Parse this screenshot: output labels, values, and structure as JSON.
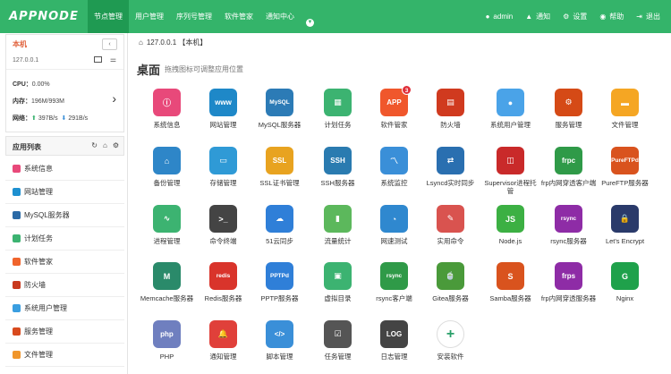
{
  "logo": "APPNODE",
  "nav": [
    {
      "label": "节点管理",
      "active": true
    },
    {
      "label": "用户管理"
    },
    {
      "label": "序列号管理"
    },
    {
      "label": "软件管家"
    },
    {
      "label": "通知中心"
    }
  ],
  "topright": {
    "user": "admin",
    "notify": "通知",
    "settings": "设置",
    "help": "帮助",
    "logout": "退出"
  },
  "host": {
    "name": "本机",
    "ip": "127.0.0.1",
    "cpu_label": "CPU：",
    "cpu": "0.00%",
    "mem_label": "内存：",
    "mem": "196M/993M",
    "net_label": "网络：",
    "net_up": "397B/s",
    "net_down": "291B/s"
  },
  "applist": {
    "title": "应用列表"
  },
  "side_items": [
    {
      "label": "系统信息",
      "color": "#e8497a"
    },
    {
      "label": "网站管理",
      "color": "#1e90d0"
    },
    {
      "label": "MySQL服务器",
      "color": "#2b6aa6"
    },
    {
      "label": "计划任务",
      "color": "#3cb371"
    },
    {
      "label": "软件管家",
      "color": "#f0642c"
    },
    {
      "label": "防火墙",
      "color": "#c8391e"
    },
    {
      "label": "系统用户管理",
      "color": "#3a9ee0"
    },
    {
      "label": "服务管理",
      "color": "#d84a1e"
    },
    {
      "label": "文件管理",
      "color": "#f0962c"
    }
  ],
  "breadcrumb": "127.0.0.1 【本机】",
  "desktop": {
    "title": "桌面",
    "hint": "拖拽图标可调整应用位置"
  },
  "apps": [
    {
      "label": "系统信息",
      "glyph": "ⓘ",
      "color": "#e8497a"
    },
    {
      "label": "网站管理",
      "glyph": "www",
      "color": "#1e88c8"
    },
    {
      "label": "MySQL服务器",
      "glyph": "MySQL",
      "color": "#2c7bb6"
    },
    {
      "label": "计划任务",
      "glyph": "▦",
      "color": "#3cb371"
    },
    {
      "label": "软件管家",
      "glyph": "APP",
      "color": "#f0572c",
      "badge": "3"
    },
    {
      "label": "防火墙",
      "glyph": "▤",
      "color": "#d03a1f"
    },
    {
      "label": "系统用户管理",
      "glyph": "●",
      "color": "#4aa3e8"
    },
    {
      "label": "服务管理",
      "glyph": "⚙",
      "color": "#d54a16"
    },
    {
      "label": "文件管理",
      "glyph": "▬",
      "color": "#f5a623"
    },
    {
      "label": "备份管理",
      "glyph": "⌂",
      "color": "#2e86c8"
    },
    {
      "label": "存储管理",
      "glyph": "▭",
      "color": "#2f9ad6"
    },
    {
      "label": "SSL证书管理",
      "glyph": "SSL",
      "color": "#e8a320"
    },
    {
      "label": "SSH服务器",
      "glyph": "SSH",
      "color": "#2a7bb0"
    },
    {
      "label": "系统监控",
      "glyph": "〽",
      "color": "#3a8fd8"
    },
    {
      "label": "Lsyncd实时同步",
      "glyph": "⇄",
      "color": "#2a6fb0"
    },
    {
      "label": "Supervisor进程托管",
      "glyph": "◫",
      "color": "#c92a2a"
    },
    {
      "label": "frp内网穿透客户端",
      "glyph": "frpc",
      "color": "#2f9a48"
    },
    {
      "label": "PureFTP服务器",
      "glyph": "PureFTPd",
      "color": "#d9531e"
    },
    {
      "label": "进程管理",
      "glyph": "∿",
      "color": "#3cb371"
    },
    {
      "label": "命令终端",
      "glyph": ">_",
      "color": "#444444"
    },
    {
      "label": "51云同步",
      "glyph": "☁",
      "color": "#2f7fd8"
    },
    {
      "label": "流量统计",
      "glyph": "▮",
      "color": "#5cb85c"
    },
    {
      "label": "网速测试",
      "glyph": "◔",
      "color": "#2f88cf"
    },
    {
      "label": "实用命令",
      "glyph": "✎",
      "color": "#d9534f"
    },
    {
      "label": "Node.js",
      "glyph": "JS",
      "color": "#3cb043"
    },
    {
      "label": "rsync服务器",
      "glyph": "rsync",
      "color": "#8e2ca6"
    },
    {
      "label": "Let's Encrypt",
      "glyph": "🔒",
      "color": "#2a3a6a"
    },
    {
      "label": "Memcache服务器",
      "glyph": "M",
      "color": "#2a8a6a"
    },
    {
      "label": "Redis服务器",
      "glyph": "redis",
      "color": "#d9342b"
    },
    {
      "label": "PPTP服务器",
      "glyph": "PPTPd",
      "color": "#2f7fd8"
    },
    {
      "label": "虚拟目录",
      "glyph": "▣",
      "color": "#3cb371"
    },
    {
      "label": "rsync客户端",
      "glyph": "rsync",
      "color": "#2f9a48"
    },
    {
      "label": "Gitea服务器",
      "glyph": "🍵",
      "color": "#4a9a3a"
    },
    {
      "label": "Samba服务器",
      "glyph": "S",
      "color": "#d9531e"
    },
    {
      "label": "frp内网穿透服务器",
      "glyph": "frps",
      "color": "#8e2ca6"
    },
    {
      "label": "Nginx",
      "glyph": "G",
      "color": "#1fa14b"
    },
    {
      "label": "PHP",
      "glyph": "php",
      "color": "#6f7fbf"
    },
    {
      "label": "通知管理",
      "glyph": "🔔",
      "color": "#e0403a"
    },
    {
      "label": "脚本管理",
      "glyph": "</>",
      "color": "#3a8fd8"
    },
    {
      "label": "任务管理",
      "glyph": "☑",
      "color": "#555555"
    },
    {
      "label": "日志管理",
      "glyph": "LOG",
      "color": "#444444"
    },
    {
      "label": "安装软件",
      "glyph": "+",
      "color": "#ffffff"
    }
  ]
}
